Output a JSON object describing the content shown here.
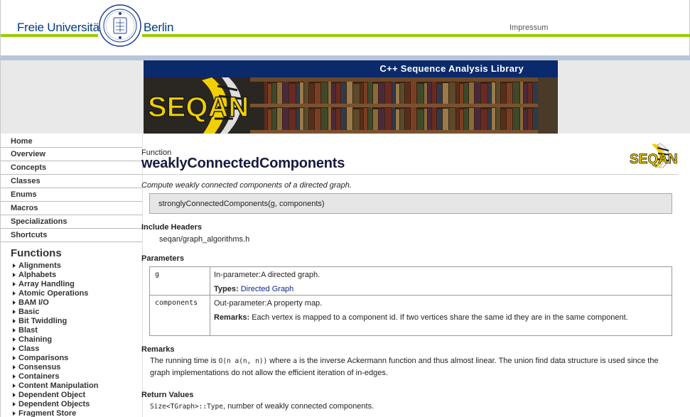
{
  "header": {
    "university_left": "Freie Universität",
    "university_right": "Berlin",
    "impressum_link": "Impressum",
    "brand_green": "#99cc00",
    "brand_blue": "#003a80"
  },
  "banner": {
    "title": "C++ Sequence Analysis Library",
    "logo_text": "SEQAN",
    "bar_color": "#0a2a6b"
  },
  "sidebar": {
    "nav_items": [
      {
        "label": "Home"
      },
      {
        "label": "Overview"
      },
      {
        "label": "Concepts"
      },
      {
        "label": "Classes"
      },
      {
        "label": "Enums"
      },
      {
        "label": "Macros"
      },
      {
        "label": "Specializations"
      },
      {
        "label": "Shortcuts"
      }
    ],
    "functions_heading": "Functions",
    "function_groups": [
      {
        "label": "Alignments"
      },
      {
        "label": "Alphabets"
      },
      {
        "label": "Array Handling"
      },
      {
        "label": "Atomic Operations"
      },
      {
        "label": "BAM I/O"
      },
      {
        "label": "Basic"
      },
      {
        "label": "Bit Twiddling"
      },
      {
        "label": "Blast"
      },
      {
        "label": "Chaining"
      },
      {
        "label": "Class"
      },
      {
        "label": "Comparisons"
      },
      {
        "label": "Consensus"
      },
      {
        "label": "Containers"
      },
      {
        "label": "Content Manipulation"
      },
      {
        "label": "Dependent Object"
      },
      {
        "label": "Dependent Objects"
      },
      {
        "label": "Fragment Store"
      }
    ]
  },
  "main": {
    "kind": "Function",
    "title": "weaklyConnectedComponents",
    "logo_text": "SEQAN",
    "summary": "Compute weakly connected components of a directed graph.",
    "signature": "stronglyConnectedComponents(g, components)",
    "include_heading": "Include Headers",
    "include_file": "seqan/graph_algorithms.h",
    "parameters_heading": "Parameters",
    "parameters": [
      {
        "name": "g",
        "description": "In-parameter:A directed graph.",
        "detail_label": "Types:",
        "detail_link": "Directed Graph"
      },
      {
        "name": "components",
        "description": "Out-parameter:A property map.",
        "detail_label": "Remarks:",
        "detail_text": "Each vertex is mapped to a component id. If two vertices share the same id they are in the same component."
      }
    ],
    "remarks_heading": "Remarks",
    "remarks_parts": {
      "p1": "The running time is ",
      "code1": "O(n a(n, n))",
      "p2": " where ",
      "code2": "a",
      "p3": " is the inverse Ackermann function and thus almost linear. The union find data structure is used since the graph implementations do not allow the efficient iteration of in-edges."
    },
    "return_heading": "Return Values",
    "return_code": "Size<TGraph>::Type",
    "return_text": ", number of weakly connected components."
  }
}
